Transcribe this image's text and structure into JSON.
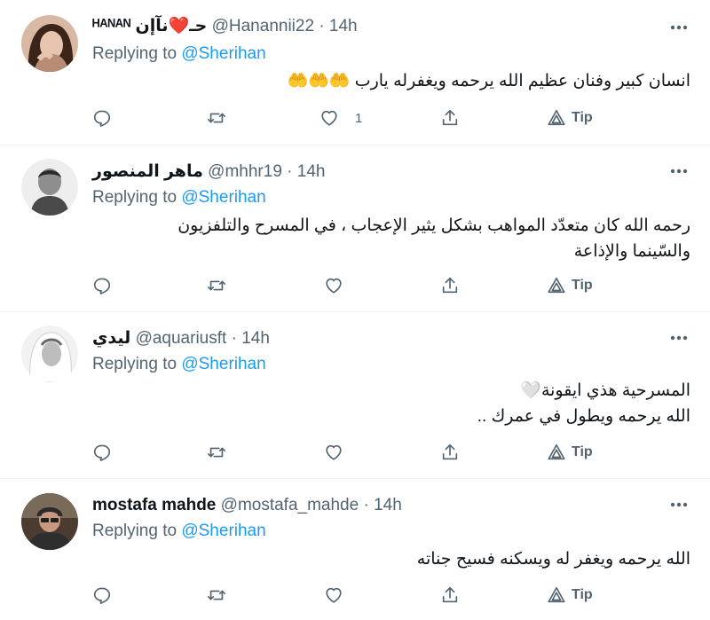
{
  "replies": [
    {
      "name": "ᴴᴬᴺᴬᴺ حـ❤️نآإن",
      "handle": "@Hanannii22",
      "time": "14h",
      "replying_prefix": "Replying to ",
      "replying_to": "@Sherihan",
      "text_lines": [
        "انسان كبير وفنان عظيم الله يرحمه ويغفرله يارب 🤲🤲🤲"
      ],
      "likes": "1",
      "tip_label": "Tip"
    },
    {
      "name": "ماهر المنصور",
      "handle": "@mhhr19",
      "time": "14h",
      "replying_prefix": "Replying to ",
      "replying_to": "@Sherihan",
      "text_lines": [
        "رحمه الله كان متعدّد المواهب بشكل يثير الإعجاب ، في المسرح والتلفزيون",
        "والسّينما والإذاعة"
      ],
      "likes": "",
      "tip_label": "Tip"
    },
    {
      "name": "ليدي",
      "handle": "@aquariusft",
      "time": "14h",
      "replying_prefix": "Replying to ",
      "replying_to": "@Sherihan",
      "text_lines": [
        "المسرحية هذي ايقونة🤍",
        "الله يرحمه ويطول في عمرك .."
      ],
      "likes": "",
      "tip_label": "Tip"
    },
    {
      "name": "mostafa mahde",
      "handle": "@mostafa_mahde",
      "time": "14h",
      "replying_prefix": "Replying to ",
      "replying_to": "@Sherihan",
      "text_lines": [
        "الله يرحمه ويغفر له ويسكنه فسيح جناته"
      ],
      "likes": "",
      "tip_label": "Tip"
    }
  ],
  "separator": "·",
  "icons": {
    "reply": "reply-icon",
    "retweet": "retweet-icon",
    "like": "heart-icon",
    "share": "share-icon",
    "tip": "tip-icon",
    "more": "more-icon"
  },
  "colors": {
    "accent": "#1d9bf0",
    "muted": "#536471",
    "text": "#0f1419",
    "divider": "#eff3f4"
  }
}
